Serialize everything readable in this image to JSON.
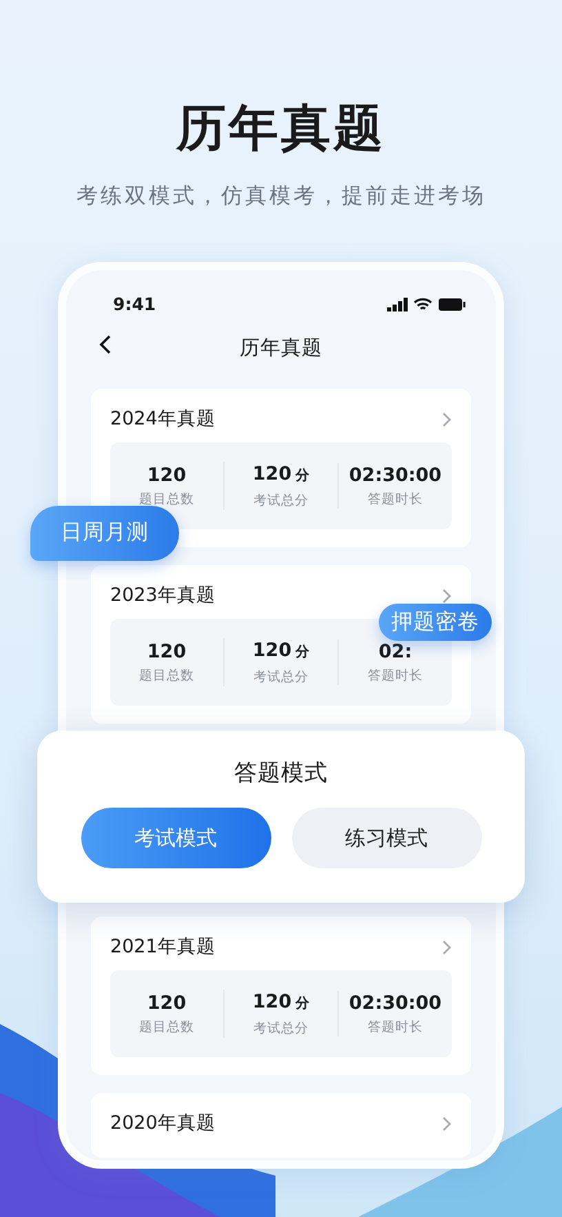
{
  "headline": "历年真题",
  "subtitle": "考练双模式，仿真模考，提前走进考场",
  "phone": {
    "status_bar": {
      "time": "9:41"
    },
    "nav_title": "历年真题",
    "papers": [
      {
        "title": "2024年真题",
        "stats": [
          {
            "value": "120",
            "label": "题目总数"
          },
          {
            "value": "120",
            "unit": "分",
            "label": "考试总分"
          },
          {
            "value": "02:30:00",
            "label": "答题时长"
          }
        ]
      },
      {
        "title": "2023年真题",
        "stats": [
          {
            "value": "120",
            "label": "题目总数"
          },
          {
            "value": "120",
            "unit": "分",
            "label": "考试总分"
          },
          {
            "value": "02:",
            "label": "答题时长"
          }
        ]
      },
      {
        "title": "2021年真题",
        "stats": [
          {
            "value": "120",
            "label": "题目总数"
          },
          {
            "value": "120",
            "unit": "分",
            "label": "考试总分"
          },
          {
            "value": "02:30:00",
            "label": "答题时长"
          }
        ]
      },
      {
        "title": "2020年真题"
      }
    ]
  },
  "tags": [
    {
      "label": "日周月测"
    },
    {
      "label": "押题密卷"
    }
  ],
  "mode_dialog": {
    "title": "答题模式",
    "options": [
      {
        "label": "考试模式",
        "selected": true
      },
      {
        "label": "练习模式",
        "selected": false
      }
    ]
  }
}
